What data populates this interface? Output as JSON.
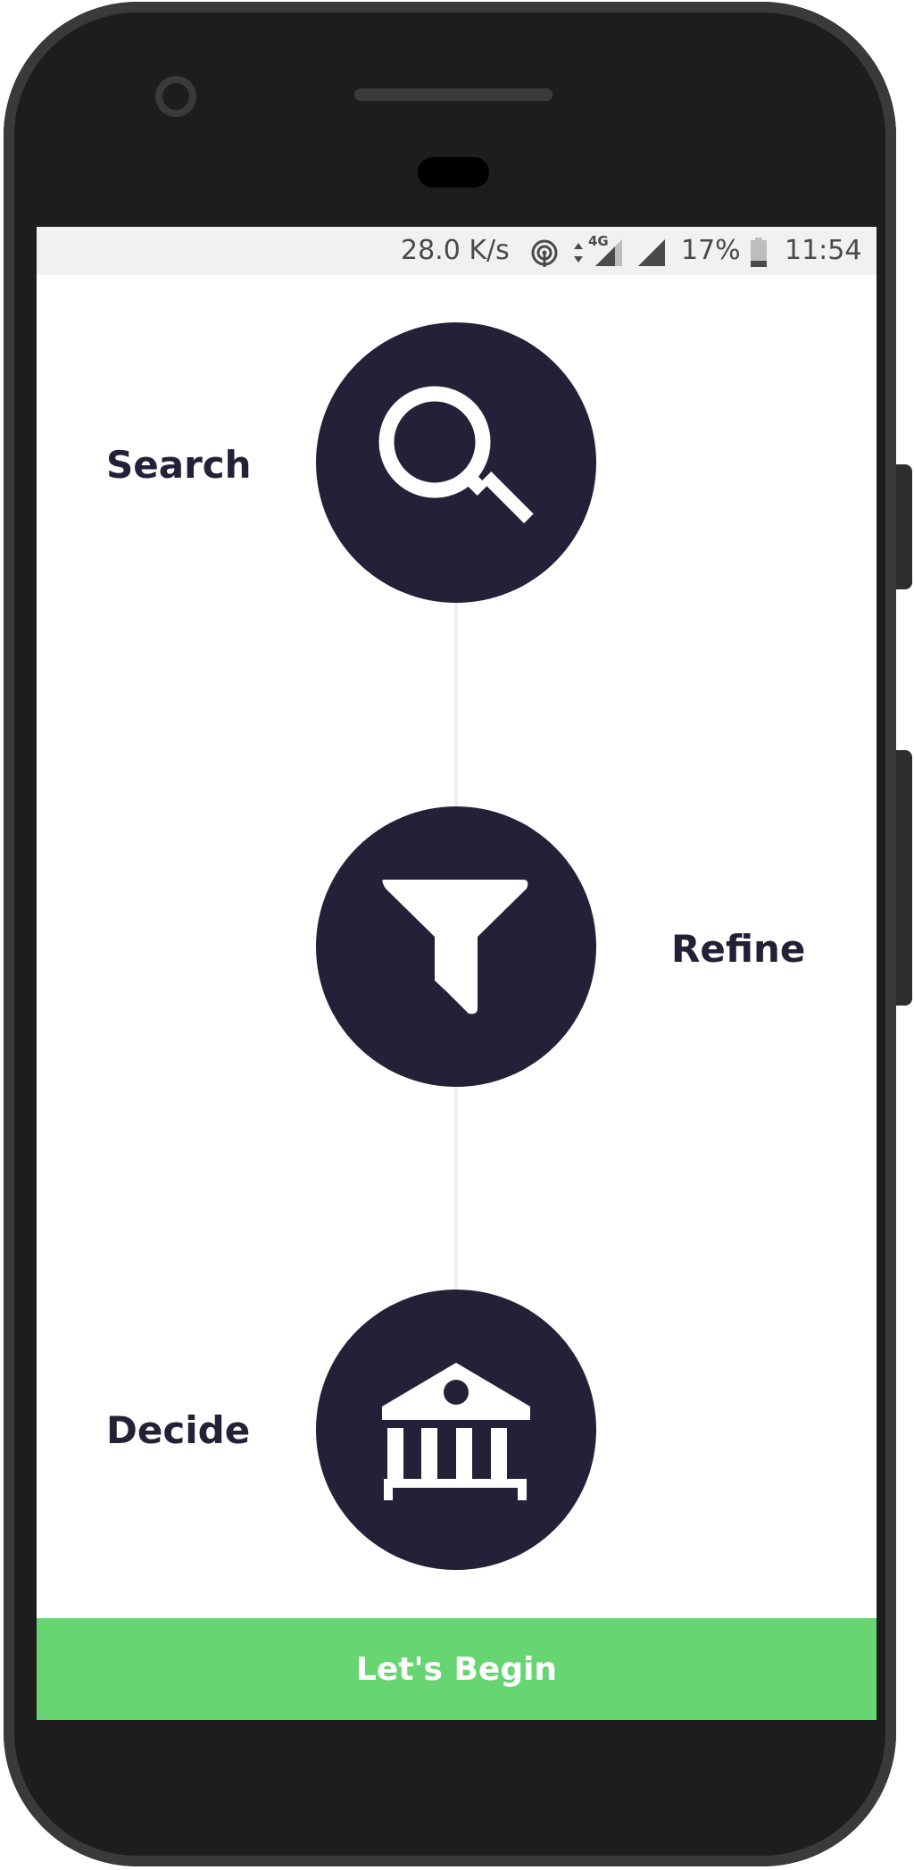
{
  "status_bar": {
    "network_speed": "28.0 K/s",
    "network_type": "4G",
    "battery": "17%",
    "time": "11:54",
    "icons": [
      "hotspot-icon",
      "data-arrows-icon",
      "signal-icon",
      "battery-icon"
    ]
  },
  "steps": [
    {
      "label": "Search",
      "icon": "search-icon"
    },
    {
      "label": "Refine",
      "icon": "filter-icon"
    },
    {
      "label": "Decide",
      "icon": "bank-icon"
    }
  ],
  "cta": {
    "label": "Let's Begin"
  },
  "colors": {
    "primary_dark": "#232037",
    "accent_green": "#67d571",
    "status_bar_bg": "#f1f1f1",
    "connector": "#eeeeee"
  }
}
